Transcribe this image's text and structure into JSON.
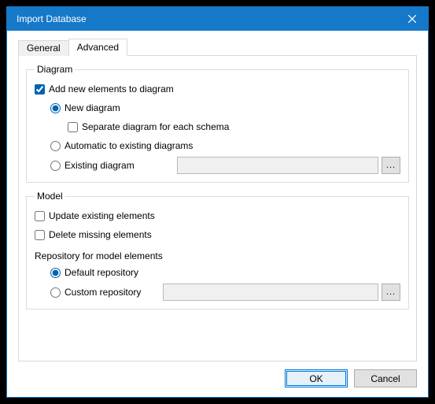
{
  "window": {
    "title": "Import Database"
  },
  "tabs": {
    "general": "General",
    "advanced": "Advanced"
  },
  "diagram": {
    "legend": "Diagram",
    "add_new": "Add new elements to diagram",
    "new_diagram": "New diagram",
    "separate_schema": "Separate diagram for each schema",
    "auto_existing": "Automatic to existing diagrams",
    "existing": "Existing diagram",
    "browse": "..."
  },
  "model": {
    "legend": "Model",
    "update_existing": "Update existing elements",
    "delete_missing": "Delete missing elements",
    "repo_heading": "Repository for model elements",
    "default_repo": "Default repository",
    "custom_repo": "Custom repository",
    "browse": "..."
  },
  "buttons": {
    "ok": "OK",
    "cancel": "Cancel"
  }
}
